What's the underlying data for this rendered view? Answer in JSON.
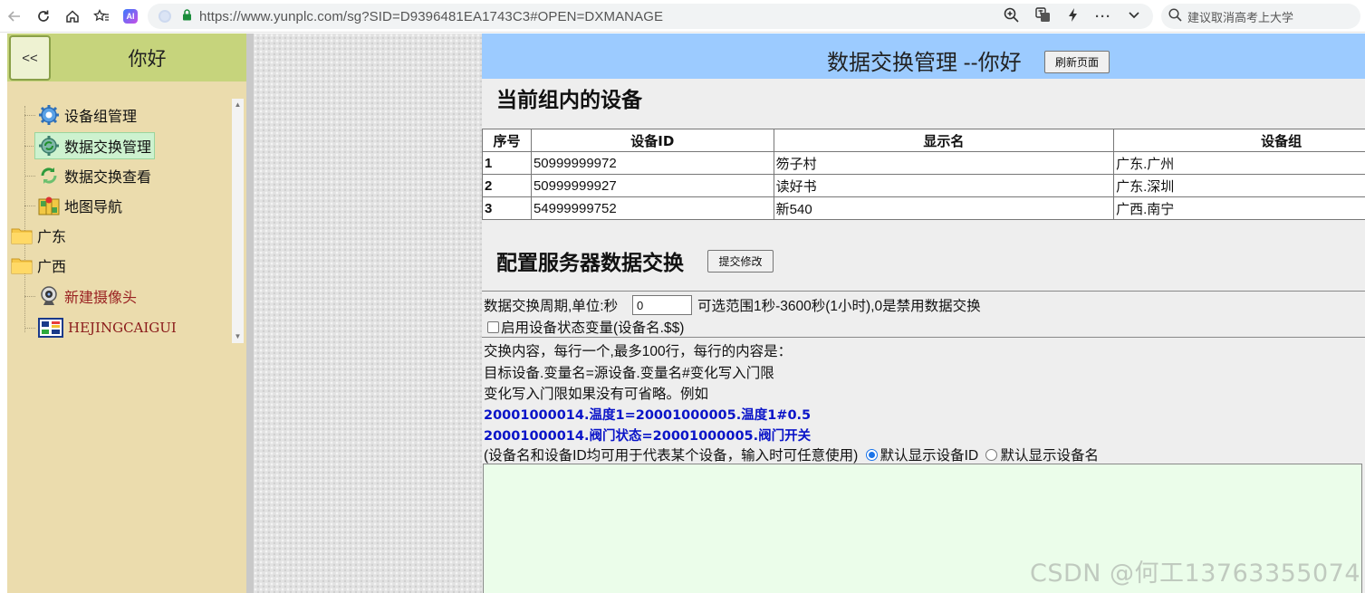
{
  "browser": {
    "url": "https://www.yunplc.com/sg?SID=D9396481EA1743C3#OPEN=DXMANAGE",
    "search_placeholder": "建议取消高考上大学"
  },
  "sidebar": {
    "collapse_label": "<<",
    "greeting": "你好",
    "items": [
      {
        "label": "设备组管理",
        "icon": "gear-icon"
      },
      {
        "label": "数据交换管理",
        "icon": "gear-refresh-icon"
      },
      {
        "label": "数据交换查看",
        "icon": "refresh-icon"
      },
      {
        "label": "地图导航",
        "icon": "map-icon"
      },
      {
        "label": "广东",
        "icon": "folder-icon"
      },
      {
        "label": "广西",
        "icon": "folder-icon"
      },
      {
        "label": "新建摄像头",
        "icon": "webcam-icon"
      },
      {
        "label": "HEJINGCAIGUI",
        "icon": "panel-icon"
      }
    ]
  },
  "main": {
    "title": "数据交换管理 --你好",
    "refresh_button": "刷新页面",
    "devices_heading": "当前组内的设备",
    "table": {
      "headers": [
        "序号",
        "设备ID",
        "显示名",
        "设备组"
      ],
      "rows": [
        [
          "1",
          "50999999972",
          "笏子村",
          "广东.广州"
        ],
        [
          "2",
          "50999999927",
          "读好书",
          "广东.深圳"
        ],
        [
          "3",
          "54999999752",
          "新540",
          "广西.南宁"
        ]
      ]
    },
    "config_heading": "配置服务器数据交换",
    "submit_button": "提交修改",
    "period_label": "数据交换周期,单位:秒",
    "period_value": "0",
    "period_hint": "可选范围1秒-3600秒(1小时),0是禁用数据交换",
    "enable_status_label": "启用设备状态变量(设备名.$$)",
    "instructions": [
      "交换内容，每行一个,最多100行，每行的内容是：",
      "目标设备.变量名=源设备.变量名#变化写入门限",
      "变化写入门限如果没有可省略。例如"
    ],
    "examples": [
      "20001000014.温度1=20001000005.温度1#0.5",
      "20001000014.阀门状态=20001000005.阀门开关"
    ],
    "note": "(设备名和设备ID均可用于代表某个设备，输入时可任意使用)",
    "radio_id_label": "默认显示设备ID",
    "radio_name_label": "默认显示设备名"
  },
  "watermark": "CSDN @何工13763355074"
}
